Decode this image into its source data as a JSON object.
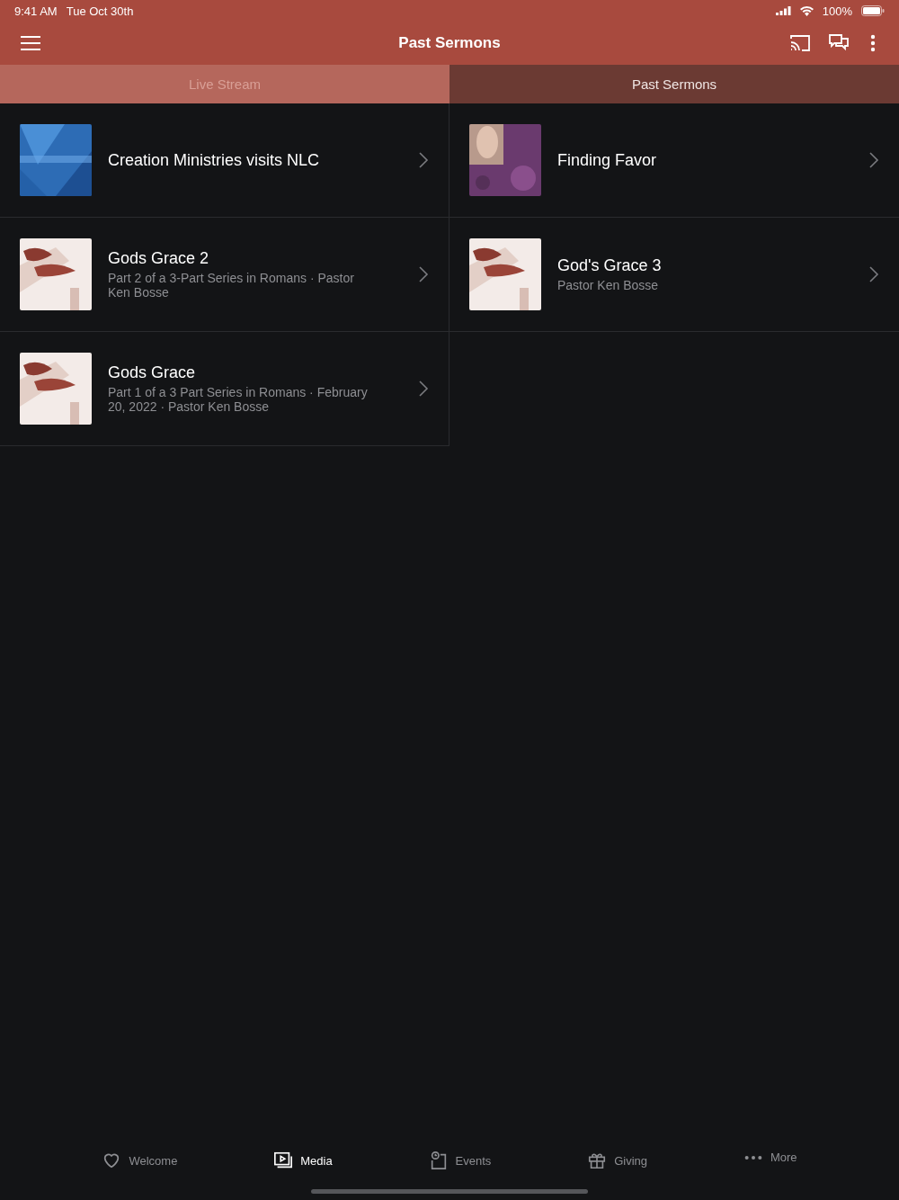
{
  "status_bar": {
    "time": "9:41 AM",
    "date": "Tue Oct 30th",
    "battery": "100%"
  },
  "header": {
    "title": "Past Sermons"
  },
  "tabs": [
    {
      "label": "Live Stream",
      "selected": false
    },
    {
      "label": "Past Sermons",
      "selected": true
    }
  ],
  "sermons": [
    {
      "title": "Creation Ministries visits NLC"
    },
    {
      "title": "Finding Favor"
    },
    {
      "title": "Gods Grace 2",
      "subtitle": "Part 2 of a 3-Part Series in Romans · Pastor Ken Bosse"
    },
    {
      "title": "God's Grace 3",
      "subtitle": "Pastor Ken Bosse"
    },
    {
      "title": "Gods Grace",
      "subtitle": "Part 1 of a 3 Part Series in Romans · February 20, 2022 · Pastor Ken Bosse"
    }
  ],
  "bottom_nav": [
    {
      "label": "Welcome",
      "kind": "heart",
      "selected": false
    },
    {
      "label": "Media",
      "kind": "media",
      "selected": true
    },
    {
      "label": "Events",
      "kind": "events",
      "selected": false
    },
    {
      "label": "Giving",
      "kind": "gift",
      "selected": false
    },
    {
      "label": "More",
      "kind": "more",
      "selected": false
    }
  ]
}
